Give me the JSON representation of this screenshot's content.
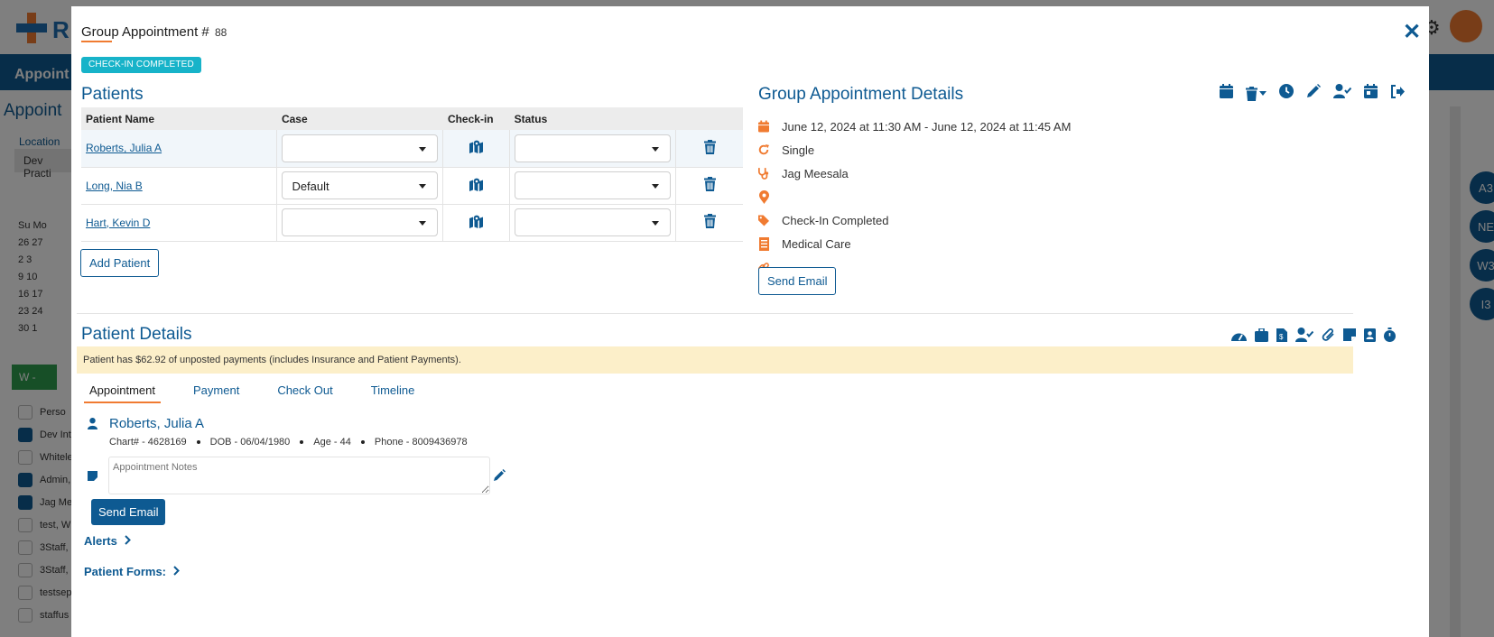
{
  "background": {
    "logo_text": "R",
    "nav_label": "Appoint",
    "side_title": "Appoint",
    "location_label": "Location",
    "location_value": "Dev Practi",
    "calendar": [
      "Su  Mo",
      "26  27",
      "2   3",
      "9   10",
      "16  17",
      "23  24",
      "30  1"
    ],
    "green_button": "W -",
    "list_header": "Perso",
    "list_items": [
      "Dev Int",
      "Whitele",
      "Admin,",
      "Jag Me",
      "test, W",
      "3Staff,",
      "3Staff,",
      "testsep",
      "staffus"
    ],
    "bubbles": [
      "A3",
      "NE",
      "W3",
      "I3"
    ]
  },
  "modal": {
    "title": "Group Appointment #",
    "number": "88",
    "close_glyph": "✕",
    "badge": "CHECK-IN COMPLETED"
  },
  "patients": {
    "title": "Patients",
    "columns": [
      "Patient Name",
      "Case",
      "Check-in",
      "Status",
      ""
    ],
    "rows": [
      {
        "name": "Roberts, Julia A",
        "case": "",
        "status": ""
      },
      {
        "name": "Long, Nia B",
        "case": "Default",
        "status": ""
      },
      {
        "name": "Hart, Kevin D",
        "case": "",
        "status": ""
      }
    ],
    "add_button": "Add Patient"
  },
  "group_details": {
    "title": "Group Appointment Details",
    "datetime": "June 12, 2024 at 11:30 AM - June 12, 2024 at 11:45 AM",
    "recurrence": "Single",
    "provider": "Jag Meesala",
    "location": "",
    "status": "Check-In Completed",
    "type": "Medical Care",
    "link": "",
    "send_email": "Send Email"
  },
  "patient_details": {
    "title": "Patient Details",
    "alert": "Patient has $62.92 of unposted payments (includes Insurance and Patient Payments).",
    "tabs": [
      "Appointment",
      "Payment",
      "Check Out",
      "Timeline"
    ],
    "active_tab": "Appointment",
    "patient_name": "Roberts, Julia A",
    "chart": "Chart# - 4628169",
    "dob": "DOB - 06/04/1980",
    "age": "Age - 44",
    "phone": "Phone - 8009436978",
    "notes_placeholder": "Appointment Notes",
    "send_email": "Send Email",
    "alerts_label": "Alerts",
    "forms_label": "Patient Forms:"
  },
  "colors": {
    "primary": "#0e5a92",
    "accent": "#f07b31",
    "badge": "#17b3c9",
    "alert_bg": "#fcefc9"
  }
}
